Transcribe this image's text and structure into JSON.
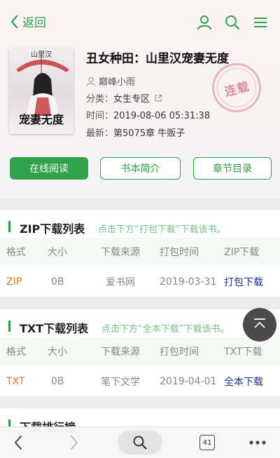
{
  "nav": {
    "back_label": "返回"
  },
  "top_icons": [
    "user-icon",
    "search-icon",
    "menu-icon"
  ],
  "book": {
    "cover_text_top": "山里汉",
    "cover_text_main": "宠妻无度",
    "title": "丑女种田：山里汉宠妻无度",
    "author": "巅峰小雨",
    "category_label": "分类：",
    "category": "女生专区",
    "time_label": "时间：",
    "time": "2019-08-06 05:31:38",
    "latest_label": "最新：",
    "latest": "第5075章 牛贩子",
    "status_stamp": "连载"
  },
  "actions": {
    "read": "在线阅读",
    "intro": "书本简介",
    "toc": "章节目录"
  },
  "zip_section": {
    "title": "ZIP下载列表",
    "hint": "点击下方“打包下载”下载该书。",
    "headers": [
      "格式",
      "大小",
      "下载来源",
      "打包时间",
      "ZIP下载"
    ],
    "row": {
      "format": "ZIP",
      "size": "0B",
      "source": "爱书网",
      "time": "2019-03-31",
      "download": "打包下载"
    }
  },
  "txt_section": {
    "title": "TXT下载列表",
    "hint": "点击下方“全本下载”下载该书。",
    "headers": [
      "格式",
      "大小",
      "下载来源",
      "打包时间",
      "TXT下载"
    ],
    "row": {
      "format": "TXT",
      "size": "0B",
      "source": "笔下文学",
      "time": "2019-04-01",
      "download": "全本下载"
    }
  },
  "rank_section": {
    "title": "下载排行榜"
  },
  "browser_bar": {
    "tabs_count": "41"
  },
  "colors": {
    "accent": "#2fa24a",
    "link": "#1a33a8",
    "format": "#e07a2a"
  }
}
